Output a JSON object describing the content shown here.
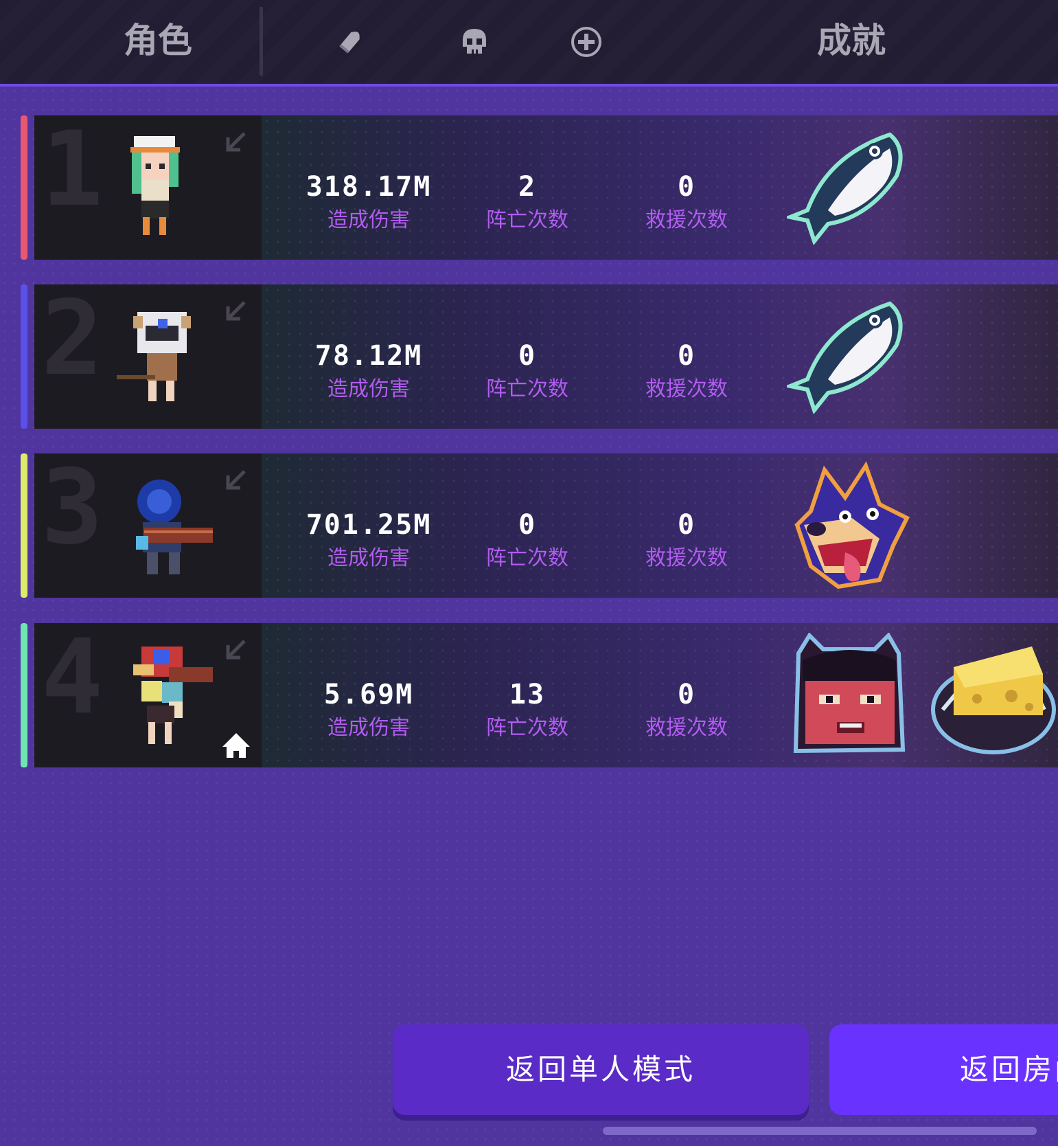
{
  "header": {
    "tab_character": "角色",
    "tab_achievement": "成就",
    "icons": [
      "bullet-icon",
      "skull-icon",
      "plus-circle-icon"
    ]
  },
  "players": [
    {
      "rank": "1",
      "rank_color": "#e8586f",
      "damage": "318.17M",
      "damage_label": "造成伤害",
      "deaths": "2",
      "deaths_label": "阵亡次数",
      "rescues": "0",
      "rescues_label": "救援次数",
      "badges": [
        "fish-badge"
      ],
      "host": false
    },
    {
      "rank": "2",
      "rank_color": "#5b50e8",
      "damage": "78.12M",
      "damage_label": "造成伤害",
      "deaths": "0",
      "deaths_label": "阵亡次数",
      "rescues": "0",
      "rescues_label": "救援次数",
      "badges": [
        "fish-badge"
      ],
      "host": false
    },
    {
      "rank": "3",
      "rank_color": "#dcec6a",
      "damage": "701.25M",
      "damage_label": "造成伤害",
      "deaths": "0",
      "deaths_label": "阵亡次数",
      "rescues": "0",
      "rescues_label": "救援次数",
      "badges": [
        "wolf-badge"
      ],
      "host": false
    },
    {
      "rank": "4",
      "rank_color": "#6ee6b0",
      "damage": "5.69M",
      "damage_label": "造成伤害",
      "deaths": "13",
      "deaths_label": "阵亡次数",
      "rescues": "0",
      "rescues_label": "救援次数",
      "badges": [
        "demon-badge",
        "cheese-trap-badge"
      ],
      "host": true
    }
  ],
  "buttons": {
    "return_single": "返回单人模式",
    "return_room": "返回房间"
  },
  "colors": {
    "background": "#50359f",
    "accent": "#6e4be6",
    "stat_label": "#b25cf0"
  }
}
